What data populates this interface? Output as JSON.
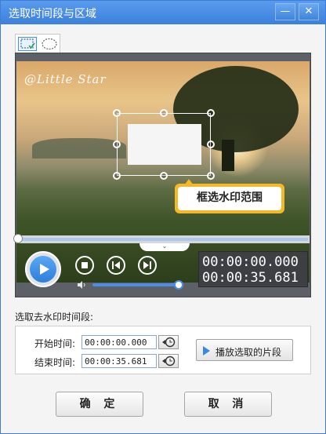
{
  "window": {
    "title": "选取时间段与区域",
    "minimize_glyph": "—",
    "close_glyph": "✕"
  },
  "mode_tabs": {
    "rect_icon": "rect-select-icon",
    "ellipse_icon": "ellipse-select-icon"
  },
  "video": {
    "watermark_text": "@Little Star",
    "tooltip": "框选水印范围",
    "progress": 0.0
  },
  "controls": {
    "current_time": "00:00:00.000",
    "total_time": "00:00:35.681",
    "volume": 1.0
  },
  "section": {
    "label": "选取去水印时间段:"
  },
  "range": {
    "start_label": "开始时间:",
    "start_value": "00:00:00.000",
    "end_label": "结束时间:",
    "end_value": "00:00:35.681",
    "play_segment_label": "播放选取的片段"
  },
  "buttons": {
    "ok": "确 定",
    "cancel": "取 消"
  },
  "colors": {
    "accent": "#3a86e0",
    "title_bar": "#3b80dc",
    "tooltip": "#f5b928"
  }
}
